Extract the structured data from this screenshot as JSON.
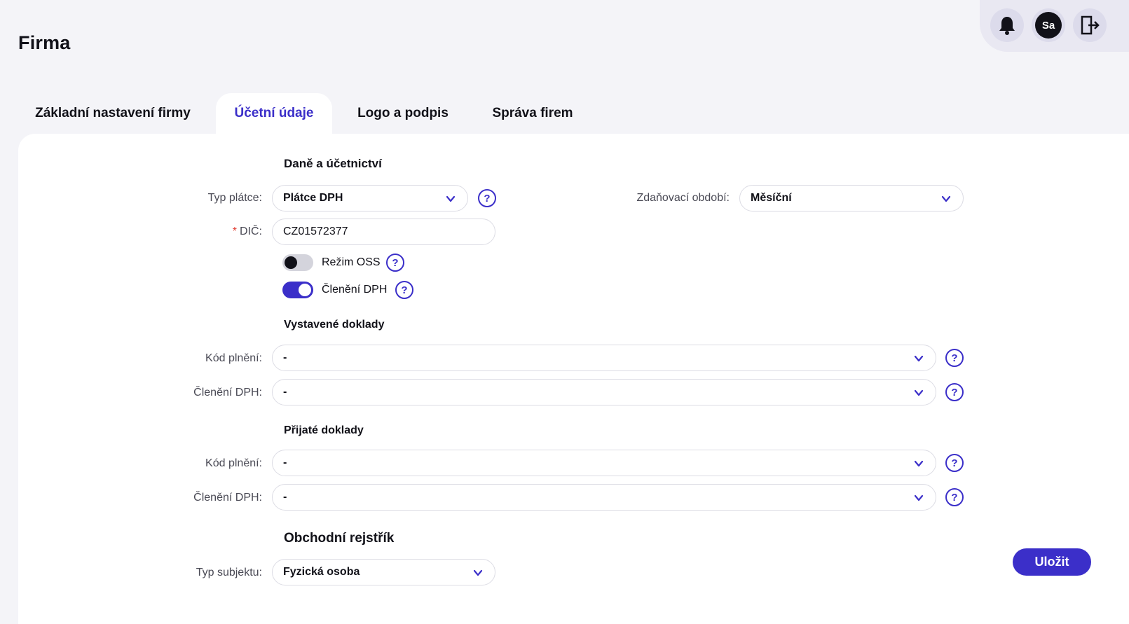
{
  "header": {
    "title": "Firma",
    "avatar_initials": "Sa",
    "icons": [
      "bell-icon",
      "avatar",
      "logout-icon"
    ]
  },
  "tabs": [
    {
      "label": "Základní nastavení firmy",
      "active": false
    },
    {
      "label": "Účetní údaje",
      "active": true
    },
    {
      "label": "Logo a podpis",
      "active": false
    },
    {
      "label": "Správa firem",
      "active": false
    }
  ],
  "tax": {
    "section_title": "Daně a účetnictví",
    "payer_type_label": "Typ plátce:",
    "payer_type_value": "Plátce DPH",
    "tax_period_label": "Zdaňovací období:",
    "tax_period_value": "Měsíční",
    "dic_label": "DIČ:",
    "dic_required": "*",
    "dic_value": "CZ01572377",
    "oss_label": "Režim OSS",
    "oss_on": false,
    "vat_split_label": "Členění DPH",
    "vat_split_on": true
  },
  "issued": {
    "section_title": "Vystavené doklady",
    "code_label": "Kód plnění:",
    "code_value": "-",
    "vat_label": "Členění DPH:",
    "vat_value": "-"
  },
  "received": {
    "section_title": "Přijaté doklady",
    "code_label": "Kód plnění:",
    "code_value": "-",
    "vat_label": "Členění DPH:",
    "vat_value": "-"
  },
  "registry": {
    "section_title": "Obchodní rejstřík",
    "subject_label": "Typ subjektu:",
    "subject_value": "Fyzická osoba"
  },
  "actions": {
    "save_label": "Uložit"
  },
  "colors": {
    "accent": "#3b2fc9",
    "background": "#f4f4f8",
    "panel": "#ffffff",
    "required": "#e03a2f"
  },
  "help_glyph": "?"
}
